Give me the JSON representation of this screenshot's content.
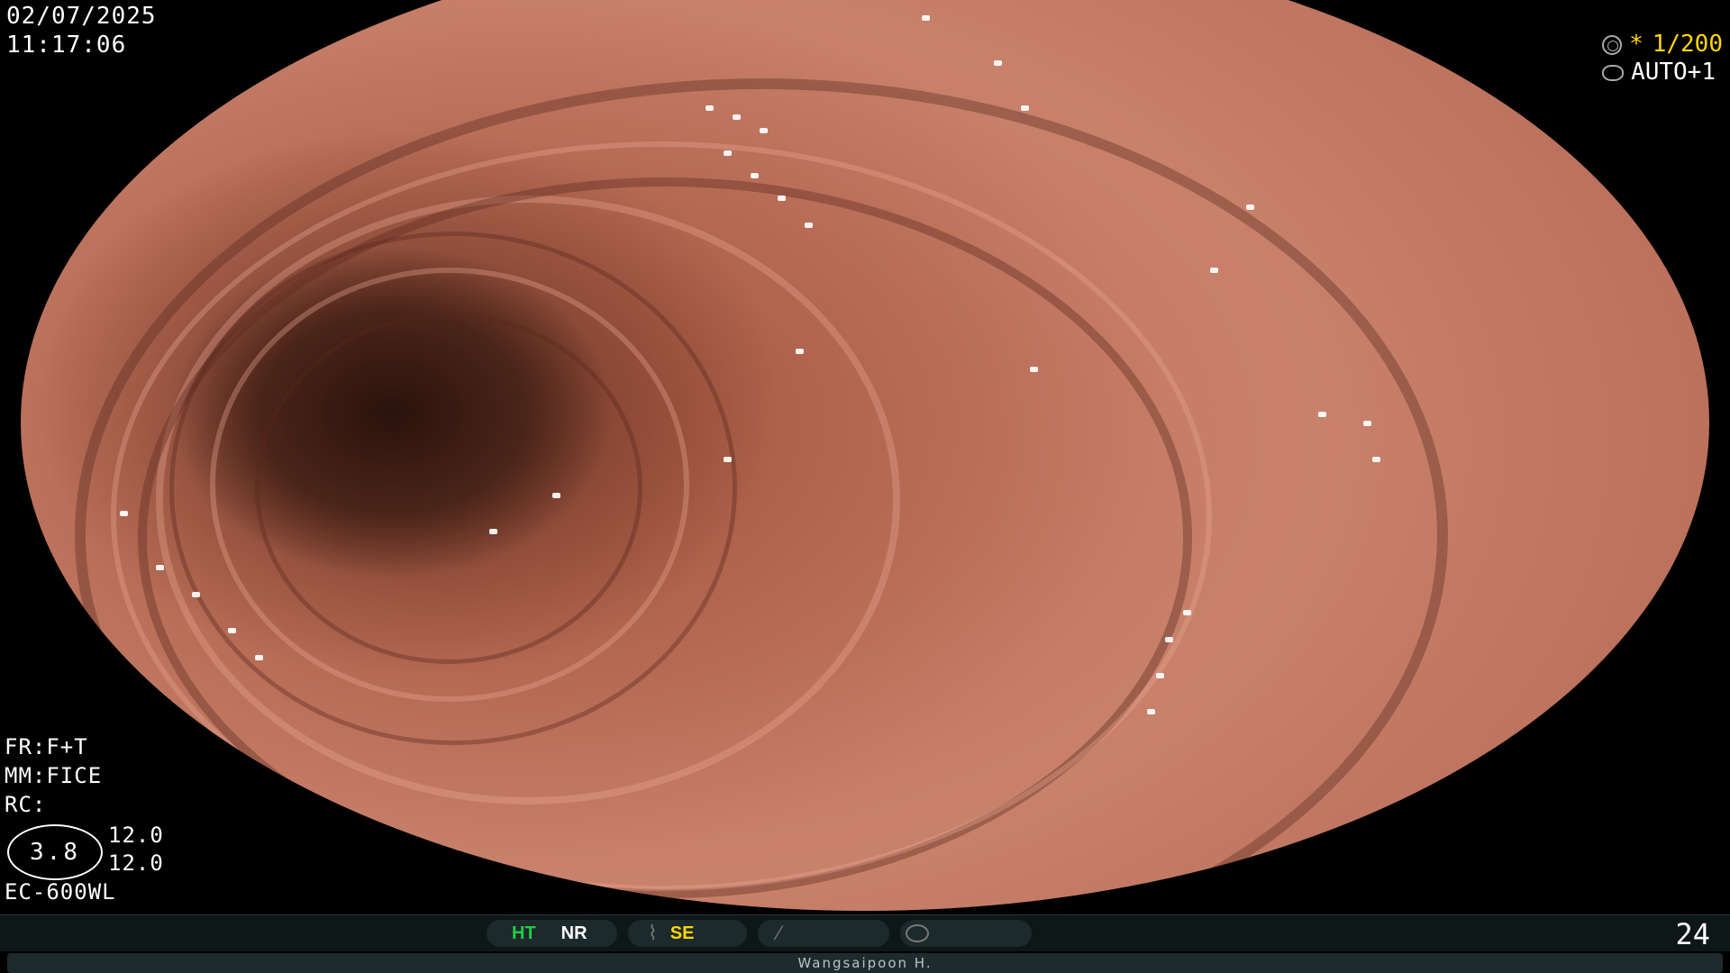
{
  "overlay": {
    "date": "02/07/2025",
    "time": "11:17:06",
    "fr": "FR:F+T",
    "mm": "MM:FICE",
    "rc": "RC:",
    "iris": "3.8",
    "value_1": "12.0",
    "value_2": "12.0",
    "model": "EC-600WL"
  },
  "exposure": {
    "shutter_star": "*",
    "shutter": "1/200",
    "auto": "AUTO+1"
  },
  "status_bar": {
    "ht": "HT",
    "nr": "NR",
    "se": "SE",
    "frame_count": "24"
  },
  "operator": {
    "name": "Wangsaipoon H."
  },
  "icons": {
    "shutter": "shutter-icon",
    "auto": "auto-exposure-icon",
    "wave": "wave-icon",
    "slash": "slash-icon",
    "dial": "dial-icon"
  }
}
